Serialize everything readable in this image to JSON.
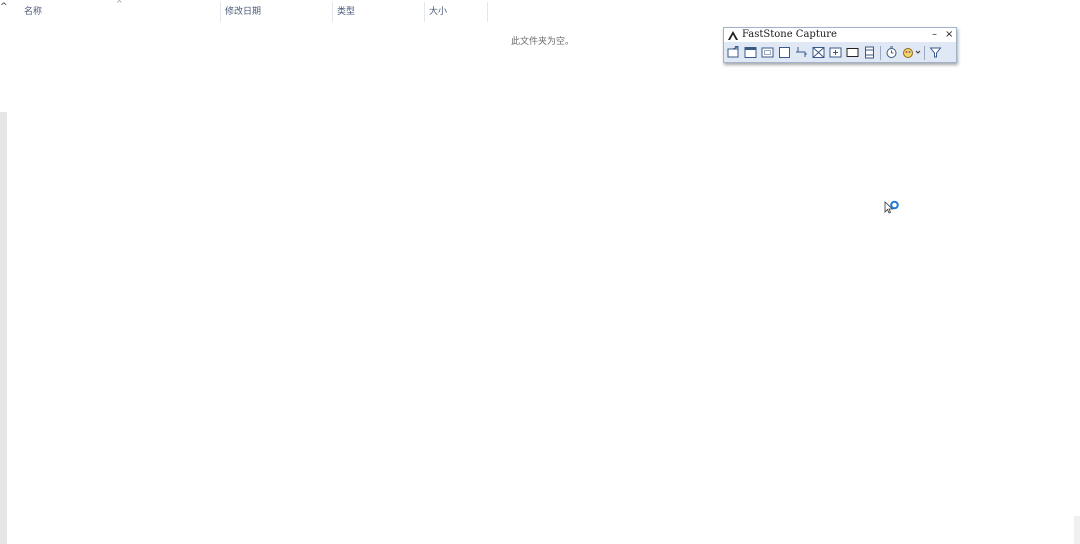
{
  "columns": {
    "name": "名称",
    "modified": "修改日期",
    "type": "类型",
    "size": "大小"
  },
  "sort_indicator": "^",
  "empty_message": "此文件夹为空。",
  "capture_toolbar": {
    "title": "FastStone Capture",
    "minimize": "–",
    "close": "×",
    "tools": [
      "capture-active-window-icon",
      "capture-window-object-icon",
      "capture-rectangle-icon",
      "capture-freehand-icon",
      "capture-full-screen-icon",
      "capture-scrolling-window-icon",
      "capture-fixed-region-icon",
      "screen-recorder-icon",
      "delay-timer-icon",
      "output-destination-icon",
      "settings-menu-icon"
    ]
  },
  "accent_color": "#1e78d6"
}
